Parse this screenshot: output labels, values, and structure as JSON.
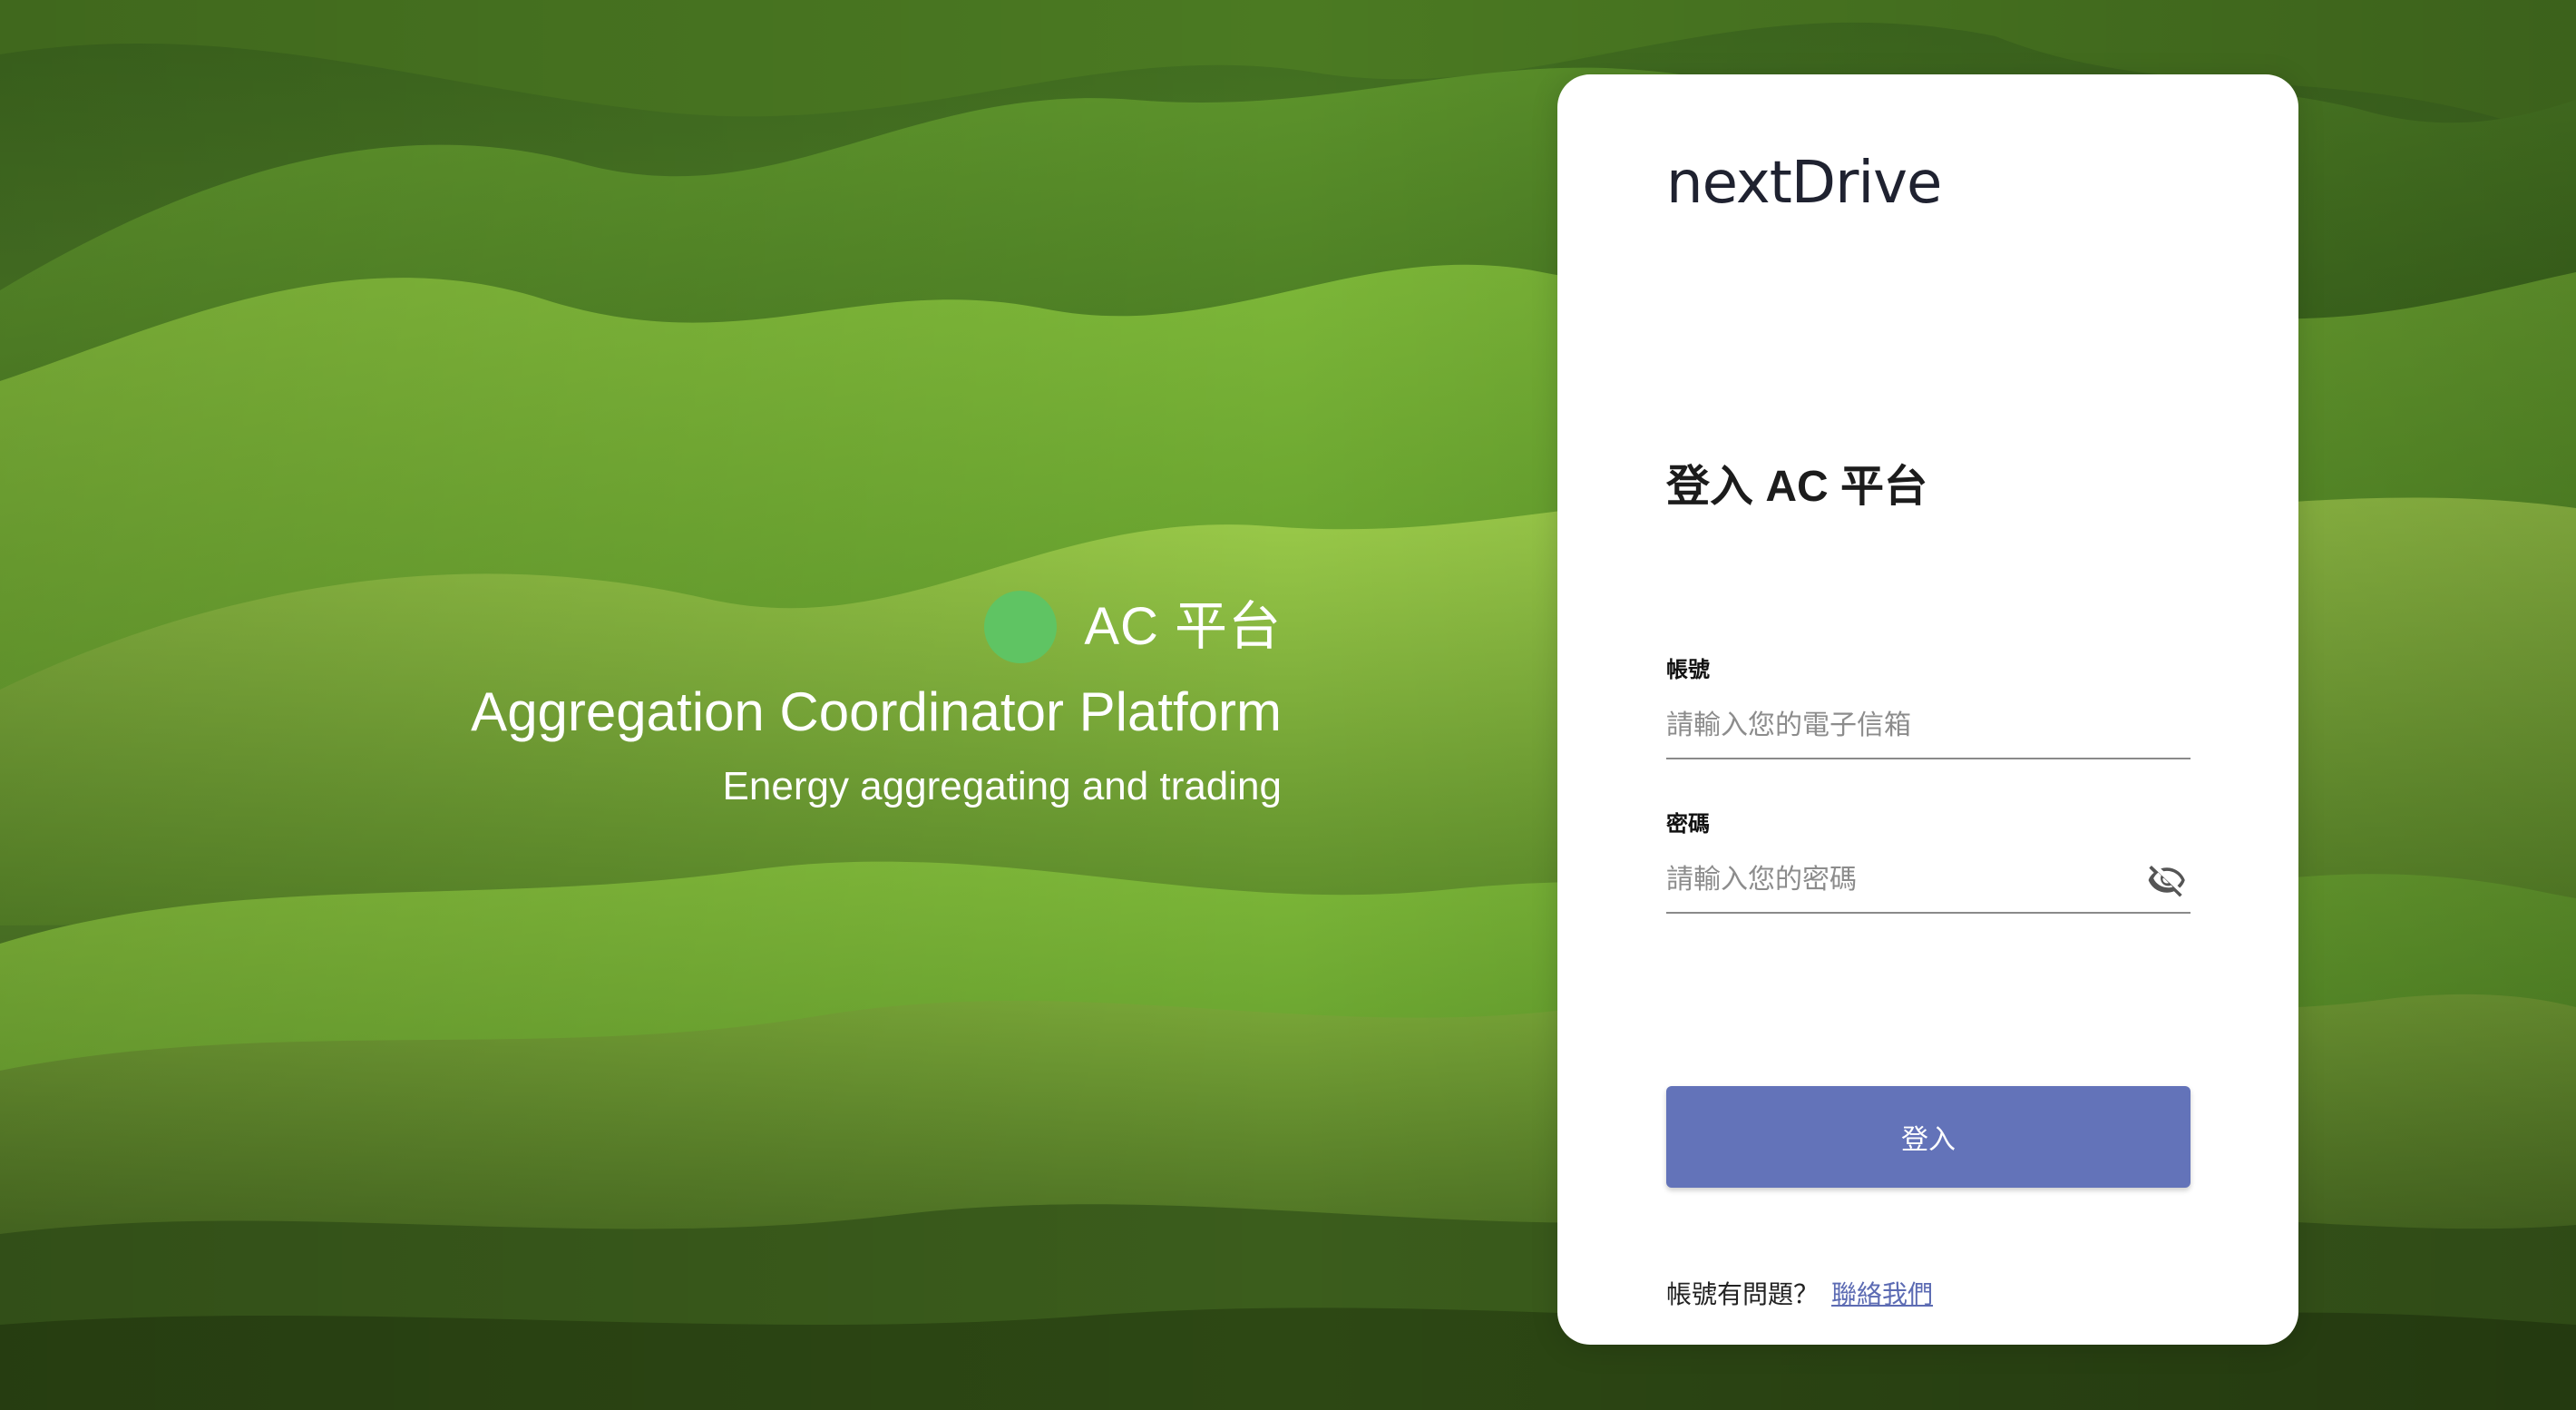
{
  "brand": {
    "name": "AC 平台",
    "tagline": "Aggregation Coordinator Platform",
    "subtitle": "Energy aggregating and trading",
    "dot_color": "#5fc463"
  },
  "card": {
    "logo_text": "nextDrive",
    "title": "登入 AC 平台",
    "account": {
      "label": "帳號",
      "placeholder": "請輸入您的電子信箱",
      "value": ""
    },
    "password": {
      "label": "密碼",
      "placeholder": "請輸入您的密碼",
      "value": "",
      "toggle_icon": "eye-off-icon"
    },
    "login_label": "登入",
    "help_text": "帳號有問題？",
    "contact_link": "聯絡我們"
  },
  "colors": {
    "primary": "#6373b9",
    "link": "#5c6bb3"
  }
}
